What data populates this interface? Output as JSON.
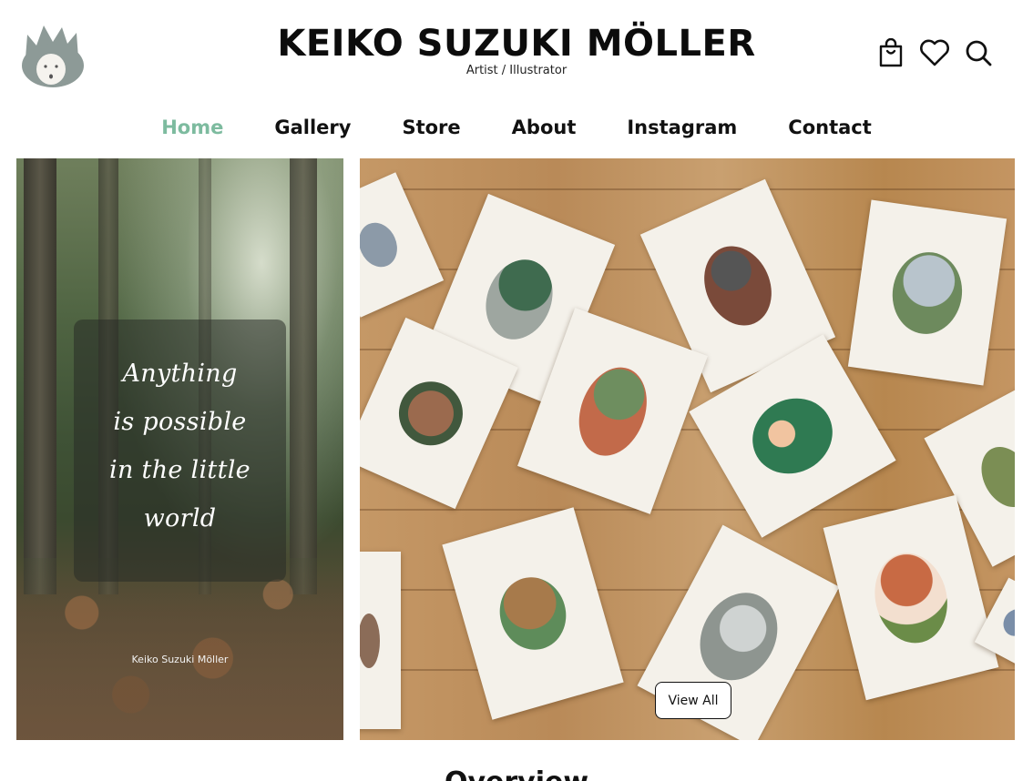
{
  "header": {
    "title": "KEIKO SUZUKI MÖLLER",
    "subtitle": "Artist / Illustrator",
    "icons": [
      "shopping-bag-icon",
      "heart-icon",
      "search-icon"
    ]
  },
  "nav": {
    "items": [
      {
        "label": "Home",
        "active": true
      },
      {
        "label": "Gallery",
        "active": false
      },
      {
        "label": "Store",
        "active": false
      },
      {
        "label": "About",
        "active": false
      },
      {
        "label": "Instagram",
        "active": false
      },
      {
        "label": "Contact",
        "active": false
      }
    ]
  },
  "hero": {
    "quote_lines": [
      "Anything",
      "is possible",
      "in the little",
      "world"
    ],
    "caption": "Keiko Suzuki Möller",
    "view_all_label": "View All"
  },
  "next_section_heading": "Overview",
  "colors": {
    "nav_active": "#7dbb9f",
    "text": "#111111",
    "background": "#ffffff"
  }
}
